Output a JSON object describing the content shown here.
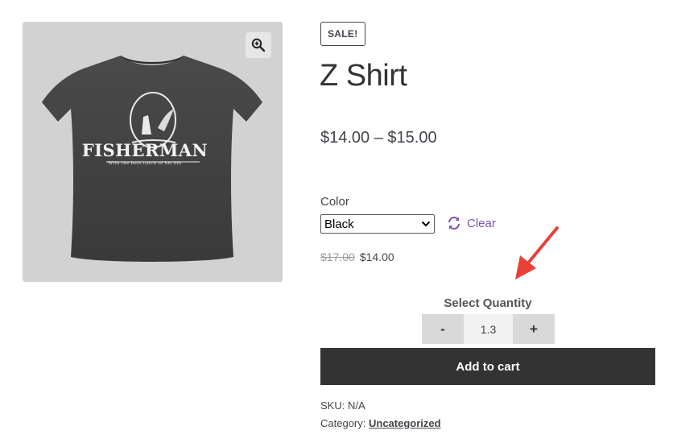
{
  "gallery": {
    "shirt_brand": "FISHERMAN",
    "shirt_tagline": "With the best catch of his life"
  },
  "product": {
    "sale_badge": "SALE!",
    "title": "Z Shirt",
    "price_range": "$14.00 – $15.00",
    "attribute_label": "Color",
    "color_selected": "Black",
    "clear_label": "Clear",
    "old_price": "$17.00",
    "new_price": "$14.00"
  },
  "quantity": {
    "label": "Select Quantity",
    "minus": "-",
    "value": "1.3",
    "plus": "+"
  },
  "cart": {
    "add_to_cart": "Add to cart"
  },
  "meta": {
    "sku": "SKU: N/A",
    "category_prefix": "Category: ",
    "category_link": "Uncategorized"
  },
  "colors": {
    "accent": "#7f54b3",
    "button": "#333333",
    "annotation": "#e8413a"
  },
  "icons": [
    "zoom-icon",
    "refresh-icon",
    "chevron-down-icon",
    "arrow-annotation"
  ]
}
